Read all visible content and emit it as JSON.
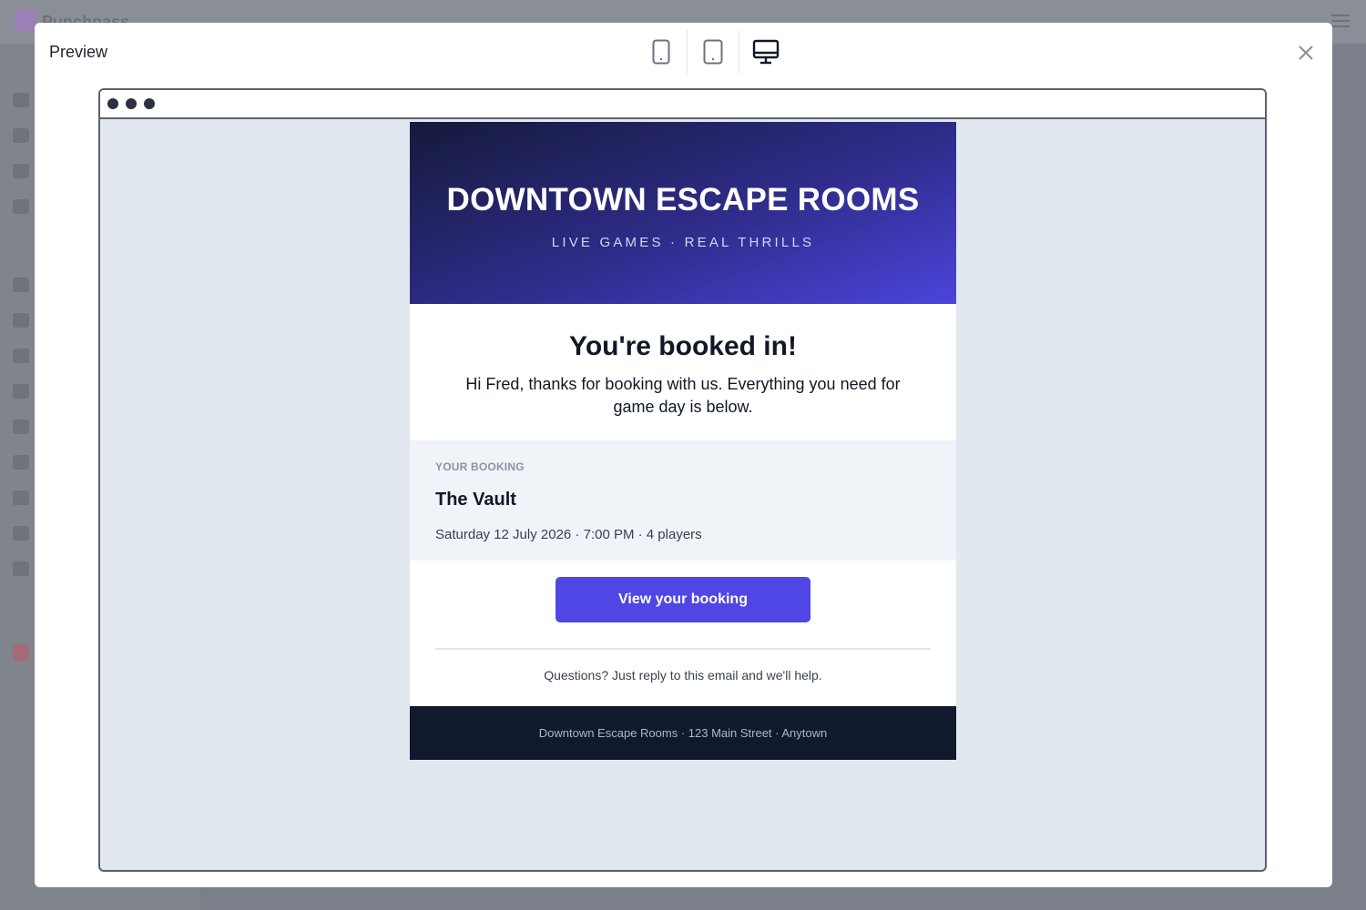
{
  "background": {
    "brand": "Punchpass"
  },
  "modal": {
    "title": "Preview",
    "devices": [
      {
        "name": "mobile",
        "icon": "mobile-icon",
        "active": false
      },
      {
        "name": "tablet",
        "icon": "tablet-icon",
        "active": false
      },
      {
        "name": "desktop",
        "icon": "desktop-icon",
        "active": true
      }
    ],
    "close_icon": "close-icon"
  },
  "email": {
    "hero_title": "DOWNTOWN ESCAPE ROOMS",
    "hero_subtitle": "LIVE GAMES · REAL THRILLS",
    "heading": "You're booked in!",
    "intro": "Hi Fred, thanks for booking with us. Everything you need for game day is below.",
    "booking_label": "YOUR BOOKING",
    "booking_name": "The Vault",
    "booking_meta": "Saturday 12 July 2026 · 7:00 PM · 4 players",
    "cta_label": "View your booking",
    "help_text": "Questions? Just reply to this email and we'll help.",
    "footer": "Downtown Escape Rooms · 123 Main Street · Anytown"
  },
  "colors": {
    "accent": "#4f46e5",
    "footer_bg": "#111a2c",
    "canvas_bg": "#e2e8f0"
  }
}
